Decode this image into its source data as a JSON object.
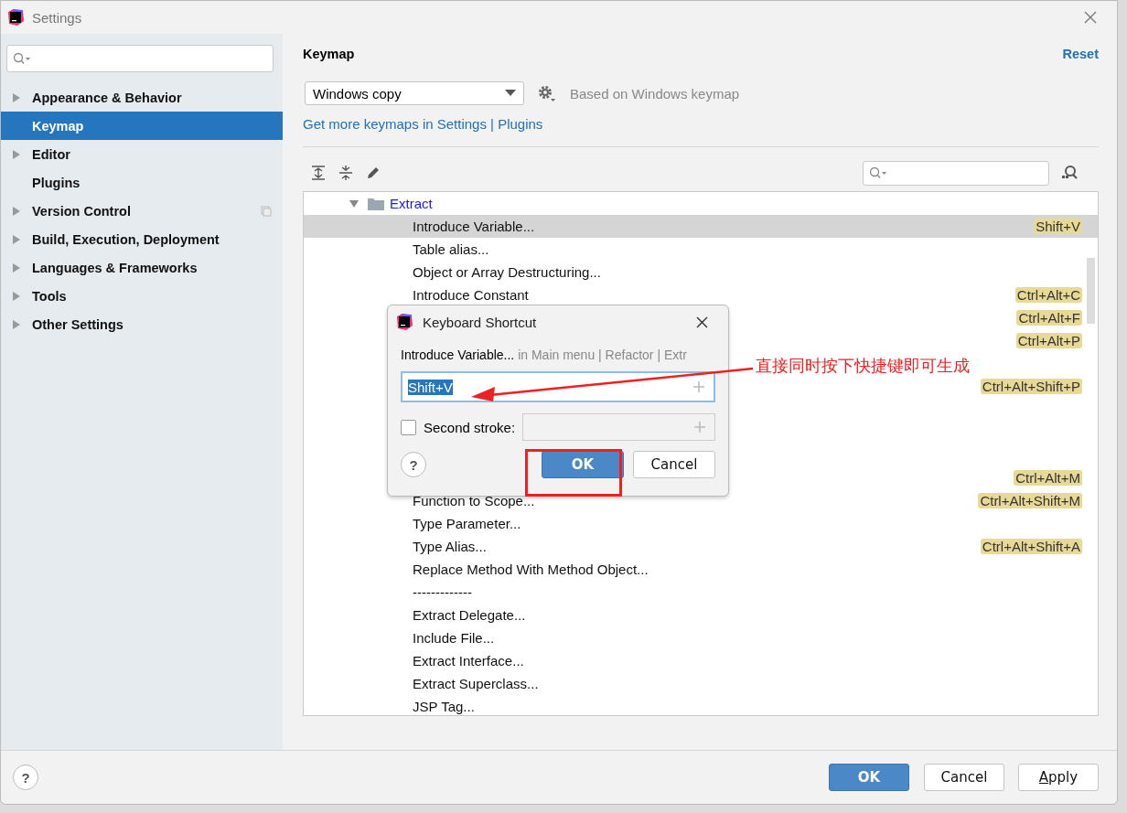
{
  "window": {
    "title": "Settings"
  },
  "sidebar": {
    "items": [
      {
        "label": "Appearance & Behavior",
        "expandable": true,
        "selected": false,
        "project_icon": false
      },
      {
        "label": "Keymap",
        "expandable": false,
        "selected": true,
        "project_icon": false
      },
      {
        "label": "Editor",
        "expandable": true,
        "selected": false,
        "project_icon": false
      },
      {
        "label": "Plugins",
        "expandable": false,
        "selected": false,
        "project_icon": false
      },
      {
        "label": "Version Control",
        "expandable": true,
        "selected": false,
        "project_icon": true
      },
      {
        "label": "Build, Execution, Deployment",
        "expandable": true,
        "selected": false,
        "project_icon": false
      },
      {
        "label": "Languages & Frameworks",
        "expandable": true,
        "selected": false,
        "project_icon": false
      },
      {
        "label": "Tools",
        "expandable": true,
        "selected": false,
        "project_icon": false
      },
      {
        "label": "Other Settings",
        "expandable": true,
        "selected": false,
        "project_icon": false
      }
    ]
  },
  "header": {
    "title": "Keymap",
    "reset": "Reset"
  },
  "keymap": {
    "value": "Windows copy",
    "based_on": "Based on Windows keymap",
    "link": "Get more keymaps in Settings | Plugins"
  },
  "tree": {
    "rows": [
      {
        "kind": "folder",
        "name": "Extract",
        "expanded": true,
        "selected": false
      },
      {
        "kind": "action",
        "name": "Introduce Variable...",
        "shortcut": "Shift+V",
        "selected": true
      },
      {
        "kind": "action",
        "name": "Table alias...",
        "selected": false
      },
      {
        "kind": "action",
        "name": "Object or Array Destructuring...",
        "selected": false
      },
      {
        "kind": "action",
        "name": "Introduce Constant",
        "shortcut": "Ctrl+Alt+C",
        "selected": false
      },
      {
        "kind": "action",
        "shortcut": "Ctrl+Alt+F",
        "selected": false
      },
      {
        "kind": "action",
        "shortcut": "Ctrl+Alt+P",
        "selected": false
      },
      {
        "kind": "action",
        "selected": false
      },
      {
        "kind": "action",
        "shortcut": "Ctrl+Alt+Shift+P",
        "selected": false
      },
      {
        "kind": "action",
        "selected": false
      },
      {
        "kind": "action",
        "selected": false
      },
      {
        "kind": "action",
        "selected": false
      },
      {
        "kind": "action",
        "shortcut": "Ctrl+Alt+M",
        "selected": false
      },
      {
        "kind": "action",
        "name": "Function to Scope...",
        "shortcut": "Ctrl+Alt+Shift+M",
        "selected": false
      },
      {
        "kind": "action",
        "name": "Type Parameter...",
        "selected": false
      },
      {
        "kind": "action",
        "name": "Type Alias...",
        "shortcut": "Ctrl+Alt+Shift+A",
        "selected": false
      },
      {
        "kind": "action",
        "name": "Replace Method With Method Object...",
        "selected": false
      },
      {
        "kind": "action",
        "name": "-------------",
        "selected": false
      },
      {
        "kind": "action",
        "name": "Extract Delegate...",
        "selected": false
      },
      {
        "kind": "action",
        "name": "Include File...",
        "selected": false
      },
      {
        "kind": "action",
        "name": "Extract Interface...",
        "selected": false
      },
      {
        "kind": "action",
        "name": "Extract Superclass...",
        "selected": false
      },
      {
        "kind": "action",
        "name": "JSP Tag...",
        "selected": false
      }
    ]
  },
  "dialog": {
    "title": "Keyboard Shortcut",
    "action": "Introduce Variable...",
    "path": " in Main menu | Refactor | Extr",
    "first_stroke": "Shift+V",
    "second_stroke_label": "Second stroke:",
    "second_stroke_checked": false,
    "ok": "OK",
    "cancel": "Cancel",
    "help": "?"
  },
  "annotation": {
    "text": "直接同时按下快捷键即可生成"
  },
  "buttons": {
    "help": "?",
    "ok": "OK",
    "cancel": "Cancel",
    "apply_mnemonic": "A",
    "apply_rest": "pply"
  }
}
